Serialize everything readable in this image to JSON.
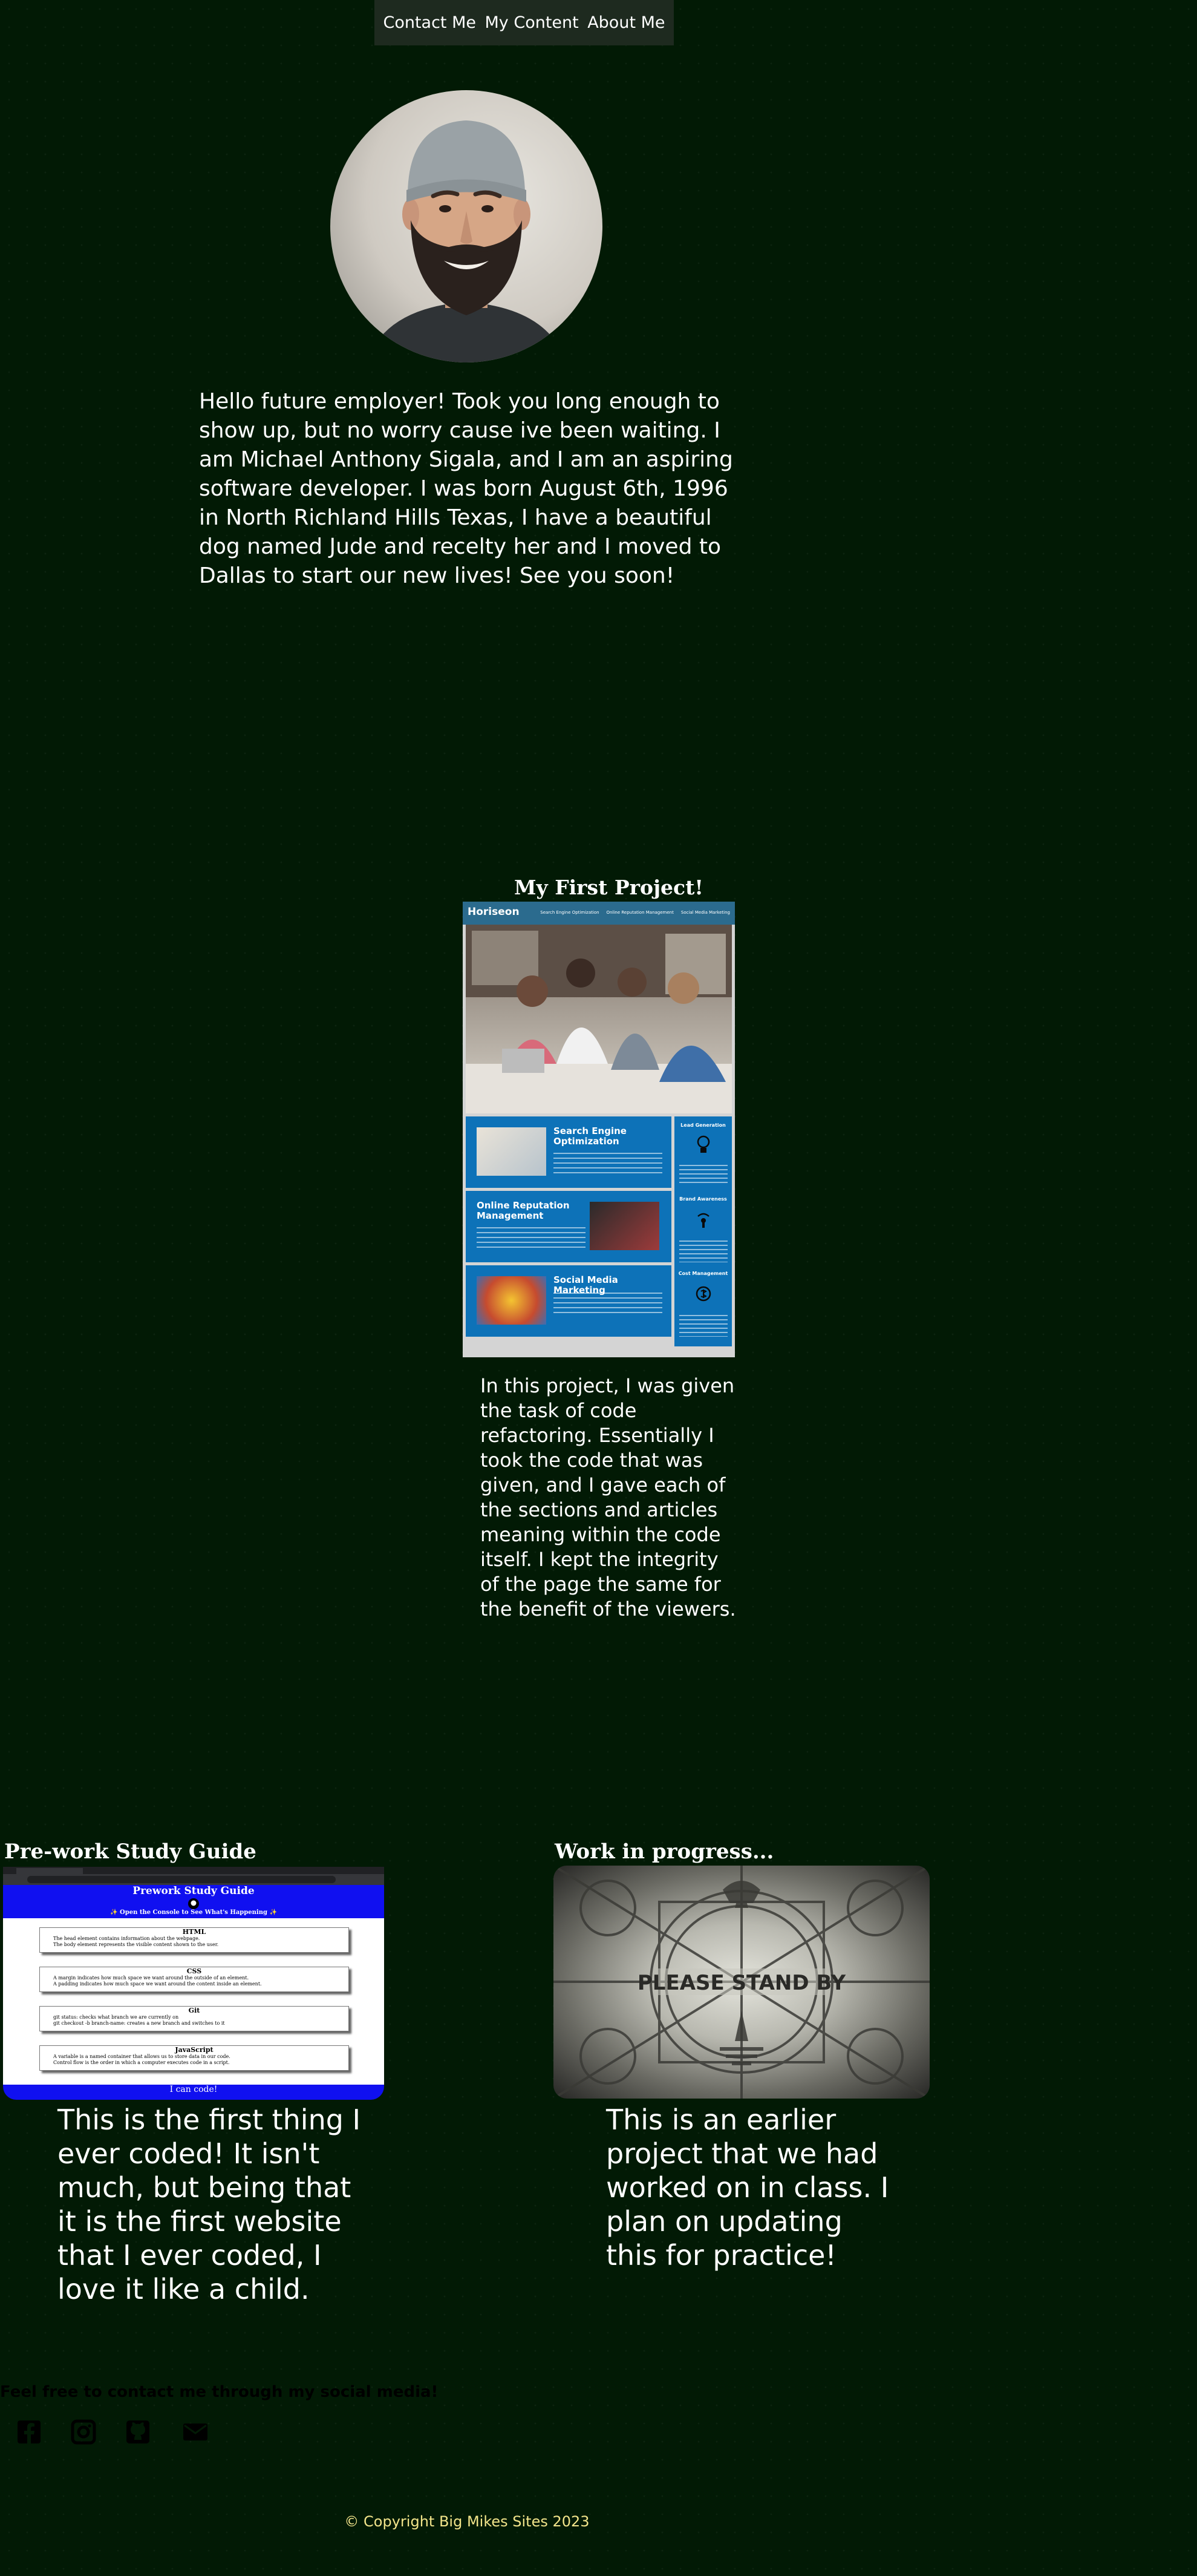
{
  "nav": {
    "items": [
      {
        "label": "Contact Me"
      },
      {
        "label": "My Content"
      },
      {
        "label": "About Me"
      }
    ]
  },
  "about": {
    "text": "Hello future employer! Took you long enough to show up, but no worry cause ive been waiting. I am Michael Anthony Sigala, and I am an aspiring software developer. I was born August 6th, 1996 in North Richland Hills Texas, I have a beautiful dog named Jude and recelty her and I moved to Dallas to start our new lives! See you soon!"
  },
  "projects": {
    "first": {
      "title": "My First Project!",
      "description": "In this project, I was given the task of code refactoring. Essentially I took the code that was given, and I gave each of the sections and articles meaning within the code itself. I kept the integrity of the page the same for the benefit of the viewers.",
      "screenshot": {
        "logo": "Horiseon",
        "nav": [
          "Search Engine Optimization",
          "Online Reputation Management",
          "Social Media Marketing"
        ],
        "cards": [
          {
            "title": "Search Engine Optimization"
          },
          {
            "title": "Online Reputation Management"
          },
          {
            "title": "Social Media Marketing"
          }
        ],
        "sidebar": [
          {
            "title": "Lead Generation"
          },
          {
            "title": "Brand Awareness"
          },
          {
            "title": "Cost Management"
          }
        ]
      }
    },
    "prework": {
      "title": "Pre-work Study Guide",
      "description": "This is the first thing I ever coded! It isn't much, but being that it is the first website that I ever coded, I love it like a child.",
      "screenshot": {
        "heading": "Prework Study Guide",
        "subheading": "✨ Open the Console to See What's Happening ✨",
        "sections": [
          {
            "title": "HTML",
            "items": [
              "The head element contains information about the webpage.",
              "The body element represents the visible content shown to the user."
            ]
          },
          {
            "title": "CSS",
            "items": [
              "A margin indicates how much space we want around the outside of an element.",
              "A padding indicates how much space we want around the content inside an element."
            ]
          },
          {
            "title": "Git",
            "items": [
              "git status: checks what branch we are currently on",
              "git checkout -b branch-name: creates a new branch and switches to it"
            ]
          },
          {
            "title": "JavaScript",
            "items": [
              "A variable is a named container that allows us to store data in our code.",
              "Control flow is the order in which a computer executes code in a script."
            ]
          }
        ],
        "footer": "I can code!"
      }
    },
    "wip": {
      "title": "Work in progress...",
      "description": "This is an earlier project that we had worked on in class. I plan on updating this for practice!",
      "screenshot": {
        "caption": "PLEASE STAND BY"
      }
    }
  },
  "footer": {
    "social_text": "Feel free to contact me through my social media!",
    "social_icons": [
      "facebook-icon",
      "instagram-icon",
      "github-icon",
      "email-icon"
    ],
    "copyright": "© Copyright Big Mikes Sites 2023"
  },
  "colors": {
    "background": "#021a05",
    "nav_background": "#1e2a1f",
    "copyright": "#f2e48a",
    "horiseon_blue": "#0d72b8",
    "prework_blue": "#1010f0"
  }
}
